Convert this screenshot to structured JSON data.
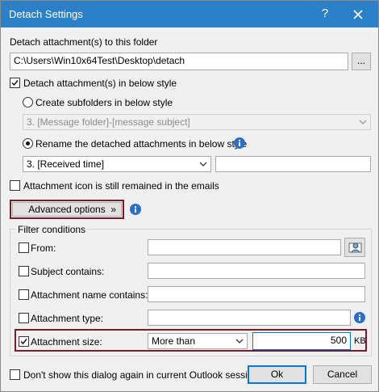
{
  "window": {
    "title": "Detach Settings",
    "help_label": "?"
  },
  "folder": {
    "label": "Detach attachment(s) to this folder",
    "path": "C:\\Users\\Win10x64Test\\Desktop\\detach",
    "browse_label": "..."
  },
  "style": {
    "checkbox_label": "Detach attachment(s) in below style",
    "subfolders_label": "Create subfolders in below style",
    "subfolders_value": "3. [Message folder]-[message subject]",
    "rename_label": "Rename the detached attachments in below style",
    "rename_value": "3. [Received time]",
    "rename_extra_value": ""
  },
  "icon_option": {
    "label": "Attachment icon is still remained in the emails"
  },
  "advanced": {
    "button_label": "Advanced options",
    "chevron": "»"
  },
  "filter": {
    "group_label": "Filter conditions",
    "from_label": "From:",
    "from_value": "",
    "subject_label": "Subject contains:",
    "subject_value": "",
    "attname_label": "Attachment name contains:",
    "attname_value": "",
    "atttype_label": "Attachment type:",
    "atttype_value": "",
    "size_label": "Attachment size:",
    "size_op": "More than",
    "size_value": "500",
    "size_unit": "KB"
  },
  "footer": {
    "dont_show_label": "Don't show this dialog again in current Outlook session.",
    "ok_label": "Ok",
    "cancel_label": "Cancel"
  },
  "colors": {
    "titlebar": "#2b80c8",
    "highlight": "#7a1b25",
    "info_icon": "#2a6fcb"
  }
}
